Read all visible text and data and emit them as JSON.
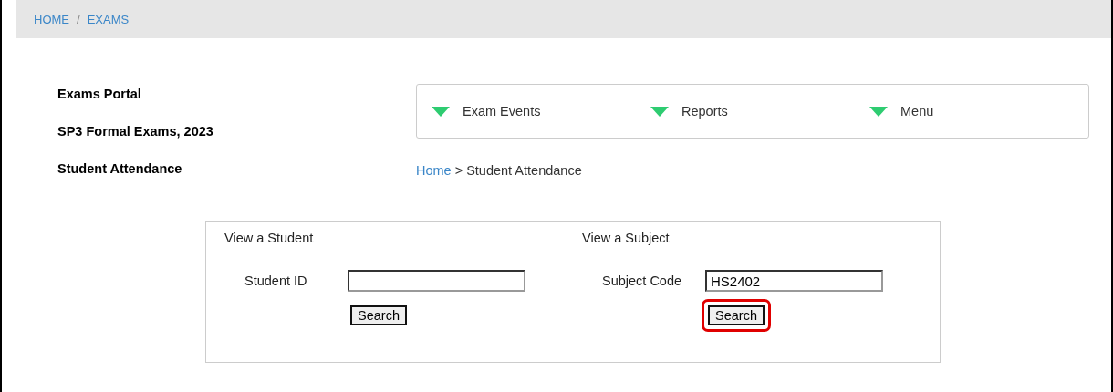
{
  "top_breadcrumb": [
    {
      "label": "HOME"
    },
    {
      "label": "/"
    },
    {
      "label": "EXAMS"
    }
  ],
  "portal": {
    "title": "Exams Portal",
    "event": "SP3 Formal Exams, 2023",
    "page": "Student Attendance"
  },
  "nav": [
    {
      "label": "Exam Events"
    },
    {
      "label": "Reports"
    },
    {
      "label": "Menu"
    }
  ],
  "breadcrumb": {
    "link": "Home",
    "separator": ">",
    "current": "Student Attendance"
  },
  "forms": [
    {
      "heading": "View a Student",
      "label": "Student ID",
      "button": "Search",
      "highlighted": false
    },
    {
      "heading": "View a Subject",
      "label": "Subject Code",
      "value": "HS2402",
      "button": "Search",
      "highlighted": true
    }
  ]
}
